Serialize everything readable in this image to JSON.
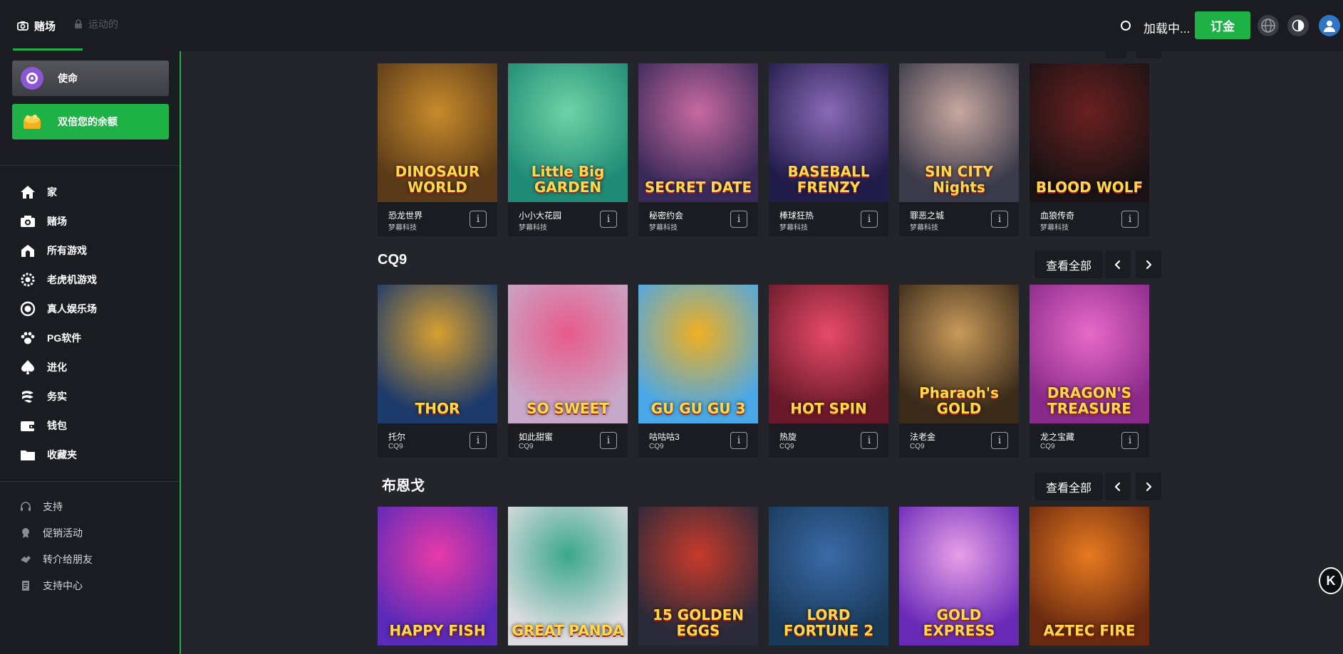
{
  "topbar": {
    "tabs": [
      {
        "label": "赌场",
        "active": true,
        "icon": "camera-icon"
      },
      {
        "label": "运动的",
        "active": false,
        "icon": "lock-icon"
      }
    ],
    "loading_text": "加载中...",
    "subscribe_label": "订金",
    "icons": [
      "globe-icon",
      "theme-toggle-icon",
      "user-avatar-icon"
    ]
  },
  "sidebar": {
    "promos": [
      {
        "label": "使命",
        "icon": "target-icon"
      },
      {
        "label": "双倍您的余额",
        "icon": "treasure-icon"
      }
    ],
    "nav": [
      {
        "label": "家",
        "icon": "home-icon"
      },
      {
        "label": "赌场",
        "icon": "camera-icon"
      },
      {
        "label": "所有游戏",
        "icon": "house-icon"
      },
      {
        "label": "老虎机游戏",
        "icon": "gear-icon"
      },
      {
        "label": "真人娱乐场",
        "icon": "target-icon"
      },
      {
        "label": "PG软件",
        "icon": "paw-icon"
      },
      {
        "label": "进化",
        "icon": "spade-icon"
      },
      {
        "label": "务实",
        "icon": "pragmatic-icon"
      },
      {
        "label": "钱包",
        "icon": "wallet-icon"
      },
      {
        "label": "收藏夹",
        "icon": "folder-icon"
      }
    ],
    "secondary": [
      {
        "label": "支持",
        "icon": "headset-icon"
      },
      {
        "label": "促销活动",
        "icon": "promo-icon"
      },
      {
        "label": "转介给朋友",
        "icon": "referral-icon"
      },
      {
        "label": "支持中心",
        "icon": "help-center-icon"
      }
    ]
  },
  "sections": [
    {
      "title": "",
      "games": [
        {
          "name": "恐龙世界",
          "provider": "梦幕科技",
          "art_title": "DINOSAUR WORLD",
          "colors": [
            "#5a3a18",
            "#c88b2c"
          ]
        },
        {
          "name": "小小大花园",
          "provider": "梦幕科技",
          "art_title": "Little Big GARDEN",
          "colors": [
            "#1f8a75",
            "#6fd3a6"
          ]
        },
        {
          "name": "秘密约会",
          "provider": "梦幕科技",
          "art_title": "SECRET DATE",
          "colors": [
            "#3a2a5a",
            "#c86aa0"
          ]
        },
        {
          "name": "棒球狂热",
          "provider": "梦幕科技",
          "art_title": "BASEBALL FRENZY",
          "colors": [
            "#221c4a",
            "#8a6ab8"
          ]
        },
        {
          "name": "罪恶之城",
          "provider": "梦幕科技",
          "art_title": "SIN CITY Nights",
          "colors": [
            "#3a3a4a",
            "#c8a8a0"
          ]
        },
        {
          "name": "血狼传奇",
          "provider": "梦幕科技",
          "art_title": "BLOOD WOLF",
          "colors": [
            "#1a1214",
            "#6a2020"
          ]
        }
      ]
    },
    {
      "title": "CQ9",
      "view_all": "查看全部",
      "games": [
        {
          "name": "托尔",
          "provider": "CQ9",
          "art_title": "THOR",
          "colors": [
            "#1c3a6a",
            "#d8a030"
          ]
        },
        {
          "name": "如此甜蜜",
          "provider": "CQ9",
          "art_title": "SO SWEET",
          "colors": [
            "#c8a8c8",
            "#e85a8a"
          ]
        },
        {
          "name": "咕咕咕3",
          "provider": "CQ9",
          "art_title": "GU GU GU 3",
          "colors": [
            "#4aa8e8",
            "#f0b020"
          ]
        },
        {
          "name": "热旋",
          "provider": "CQ9",
          "art_title": "HOT SPIN",
          "colors": [
            "#6a1a2a",
            "#e84a6a"
          ]
        },
        {
          "name": "法老金",
          "provider": "CQ9",
          "art_title": "Pharaoh's GOLD",
          "colors": [
            "#3a2a1a",
            "#c89a5a"
          ]
        },
        {
          "name": "龙之宝藏",
          "provider": "CQ9",
          "art_title": "DRAGON'S TREASURE",
          "colors": [
            "#8a2a8a",
            "#e86ac8"
          ]
        }
      ]
    },
    {
      "title": "布恩戈",
      "view_all": "查看全部",
      "games": [
        {
          "name": "",
          "provider": "",
          "art_title": "HAPPY FISH",
          "colors": [
            "#5a2ab8",
            "#e83aa8"
          ]
        },
        {
          "name": "",
          "provider": "",
          "art_title": "GREAT PANDA",
          "colors": [
            "#dcdce0",
            "#3aa88a"
          ]
        },
        {
          "name": "",
          "provider": "",
          "art_title": "15 GOLDEN EGGS",
          "colors": [
            "#2a2a3a",
            "#c83a2a"
          ]
        },
        {
          "name": "",
          "provider": "",
          "art_title": "LORD FORTUNE 2",
          "colors": [
            "#1a3a5a",
            "#3a6aa8"
          ]
        },
        {
          "name": "",
          "provider": "",
          "art_title": "GOLD EXPRESS",
          "colors": [
            "#6a2ab8",
            "#e8a0e8"
          ]
        },
        {
          "name": "",
          "provider": "",
          "art_title": "AZTEC FIRE",
          "colors": [
            "#6a2a10",
            "#e87a20"
          ]
        }
      ]
    }
  ],
  "colors": {
    "accent": "#1eb145",
    "background": "#24252b",
    "panel": "#1b1c21"
  }
}
